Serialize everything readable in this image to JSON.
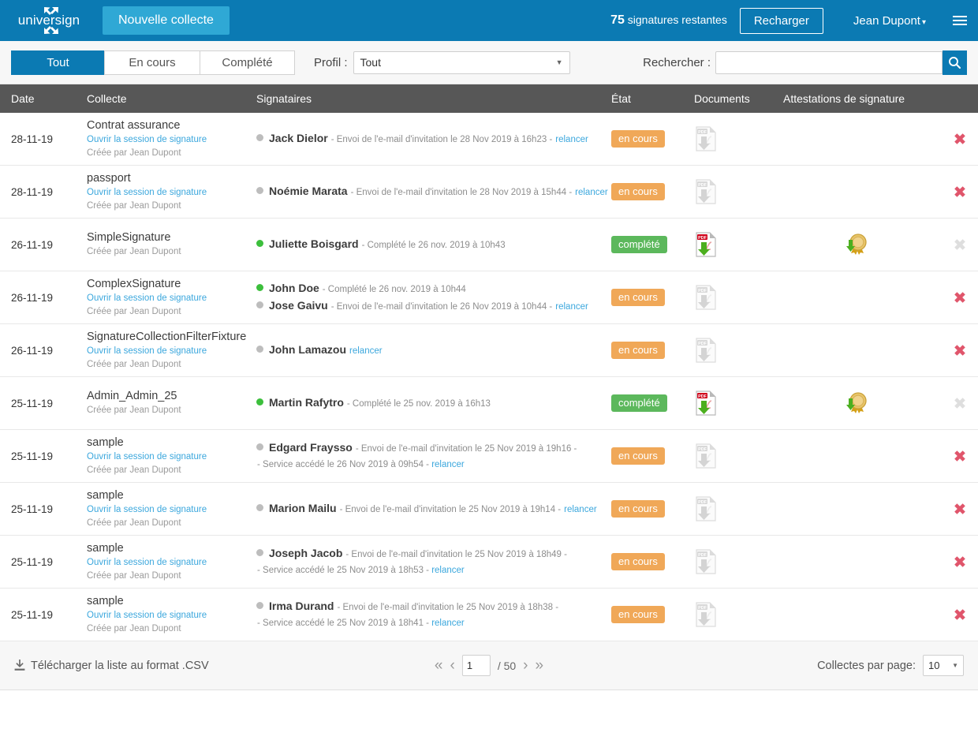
{
  "header": {
    "logo_text": "universign",
    "logo_icon": "arrows-outward-icon",
    "new_collection_button": "Nouvelle collecte",
    "signatures_count": "75",
    "signatures_label": "signatures restantes",
    "recharge_button": "Recharger",
    "user_name": "Jean Dupont",
    "user_caret": "▾",
    "menu_icon": "hamburger-menu-icon"
  },
  "filters": {
    "tabs": [
      {
        "label": "Tout",
        "active": true
      },
      {
        "label": "En cours",
        "active": false
      },
      {
        "label": "Complété",
        "active": false
      }
    ],
    "profil_label": "Profil :",
    "profil_value": "Tout",
    "profil_caret": "▼",
    "search_label": "Rechercher :",
    "search_value": "",
    "search_placeholder": "",
    "search_icon": "search-icon"
  },
  "table": {
    "columns": [
      "Date",
      "Collecte",
      "Signataires",
      "État",
      "Documents",
      "Attestations de signature"
    ],
    "labels": {
      "open_session": "Ouvrir la session de signature",
      "created_by": "Créée par Jean Dupont",
      "relancer": "relancer"
    },
    "rows": [
      {
        "date": "28-11-19",
        "collection": "Contrat assurance",
        "has_link": true,
        "created_by": "Créée par Jean Dupont",
        "signers": [
          {
            "status": "grey",
            "name": "Jack Dielor",
            "meta": "- Envoi de l'e-mail d'invitation le 28 Nov 2019 à 16h23 - ",
            "relancer": true,
            "sub": ""
          }
        ],
        "state": "en cours",
        "state_kind": "encours",
        "doc_enabled": false,
        "attestation": false,
        "delete_enabled": true
      },
      {
        "date": "28-11-19",
        "collection": "passport",
        "has_link": true,
        "created_by": "Créée par Jean Dupont",
        "signers": [
          {
            "status": "grey",
            "name": "Noémie Marata",
            "meta": "- Envoi de l'e-mail d'invitation le 28 Nov 2019 à 15h44 - ",
            "relancer": true,
            "sub": ""
          }
        ],
        "state": "en cours",
        "state_kind": "encours",
        "doc_enabled": false,
        "attestation": false,
        "delete_enabled": true
      },
      {
        "date": "26-11-19",
        "collection": "SimpleSignature",
        "has_link": false,
        "created_by": "Créée par Jean Dupont",
        "signers": [
          {
            "status": "green",
            "name": "Juliette Boisgard",
            "meta": "- Complété le 26 nov. 2019 à 10h43",
            "relancer": false,
            "sub": ""
          }
        ],
        "state": "complété",
        "state_kind": "complete",
        "doc_enabled": true,
        "attestation": true,
        "delete_enabled": false
      },
      {
        "date": "26-11-19",
        "collection": "ComplexSignature",
        "has_link": true,
        "created_by": "Créée par Jean Dupont",
        "signers": [
          {
            "status": "green",
            "name": "John Doe",
            "meta": "- Complété le 26 nov. 2019 à 10h44",
            "relancer": false,
            "sub": ""
          },
          {
            "status": "grey",
            "name": "Jose Gaivu",
            "meta": "- Envoi de l'e-mail d'invitation le 26 Nov 2019 à 10h44 - ",
            "relancer": true,
            "sub": ""
          }
        ],
        "state": "en cours",
        "state_kind": "encours",
        "doc_enabled": false,
        "attestation": false,
        "delete_enabled": true
      },
      {
        "date": "26-11-19",
        "collection": "SignatureCollectionFilterFixture",
        "has_link": true,
        "created_by": "Créée par Jean Dupont",
        "signers": [
          {
            "status": "grey",
            "name": "John Lamazou",
            "meta": "",
            "relancer": true,
            "sub": ""
          }
        ],
        "state": "en cours",
        "state_kind": "encours",
        "doc_enabled": false,
        "attestation": false,
        "delete_enabled": true
      },
      {
        "date": "25-11-19",
        "collection": "Admin_Admin_25",
        "has_link": false,
        "created_by": "Créée par Jean Dupont",
        "signers": [
          {
            "status": "green",
            "name": "Martin Rafytro",
            "meta": "- Complété le 25 nov. 2019 à 16h13",
            "relancer": false,
            "sub": ""
          }
        ],
        "state": "complété",
        "state_kind": "complete",
        "doc_enabled": true,
        "attestation": true,
        "delete_enabled": false
      },
      {
        "date": "25-11-19",
        "collection": "sample",
        "has_link": true,
        "created_by": "Créée par Jean Dupont",
        "signers": [
          {
            "status": "grey",
            "name": "Edgard Fraysso",
            "meta": "- Envoi de l'e-mail d'invitation le 25 Nov 2019 à 19h16 -",
            "relancer": false,
            "sub": "- Service accédé le 26 Nov 2019 à 09h54 - ",
            "sub_relancer": true
          }
        ],
        "state": "en cours",
        "state_kind": "encours",
        "doc_enabled": false,
        "attestation": false,
        "delete_enabled": true
      },
      {
        "date": "25-11-19",
        "collection": "sample",
        "has_link": true,
        "created_by": "Créée par Jean Dupont",
        "signers": [
          {
            "status": "grey",
            "name": "Marion Mailu",
            "meta": "- Envoi de l'e-mail d'invitation le 25 Nov 2019 à 19h14 - ",
            "relancer": true,
            "sub": ""
          }
        ],
        "state": "en cours",
        "state_kind": "encours",
        "doc_enabled": false,
        "attestation": false,
        "delete_enabled": true
      },
      {
        "date": "25-11-19",
        "collection": "sample",
        "has_link": true,
        "created_by": "Créée par Jean Dupont",
        "signers": [
          {
            "status": "grey",
            "name": "Joseph Jacob",
            "meta": "- Envoi de l'e-mail d'invitation le 25 Nov 2019 à 18h49 -",
            "relancer": false,
            "sub": "- Service accédé le 25 Nov 2019 à 18h53 - ",
            "sub_relancer": true
          }
        ],
        "state": "en cours",
        "state_kind": "encours",
        "doc_enabled": false,
        "attestation": false,
        "delete_enabled": true
      },
      {
        "date": "25-11-19",
        "collection": "sample",
        "has_link": true,
        "created_by": "Créée par Jean Dupont",
        "signers": [
          {
            "status": "grey",
            "name": "Irma Durand",
            "meta": "- Envoi de l'e-mail d'invitation le 25 Nov 2019 à 18h38 -",
            "relancer": false,
            "sub": "- Service accédé le 25 Nov 2019 à 18h41 - ",
            "sub_relancer": true
          }
        ],
        "state": "en cours",
        "state_kind": "encours",
        "doc_enabled": false,
        "attestation": false,
        "delete_enabled": true
      }
    ]
  },
  "footer": {
    "csv_label": "Télécharger la liste au format .CSV",
    "csv_icon": "download-icon",
    "first_icon": "double-chevron-left-icon",
    "prev_icon": "chevron-left-icon",
    "page_value": "1",
    "page_total": "/ 50",
    "next_icon": "chevron-right-icon",
    "last_icon": "double-chevron-right-icon",
    "perpage_label": "Collectes par page:",
    "perpage_value": "10",
    "perpage_caret": "▼"
  },
  "colors": {
    "brand_blue": "#0b7ab3",
    "accent_cyan": "#2fa8d5",
    "link_blue": "#3ba7dd",
    "badge_orange": "#f0a858",
    "badge_green": "#5cb85c",
    "header_grey": "#575757",
    "delete_red": "#e0556b"
  }
}
